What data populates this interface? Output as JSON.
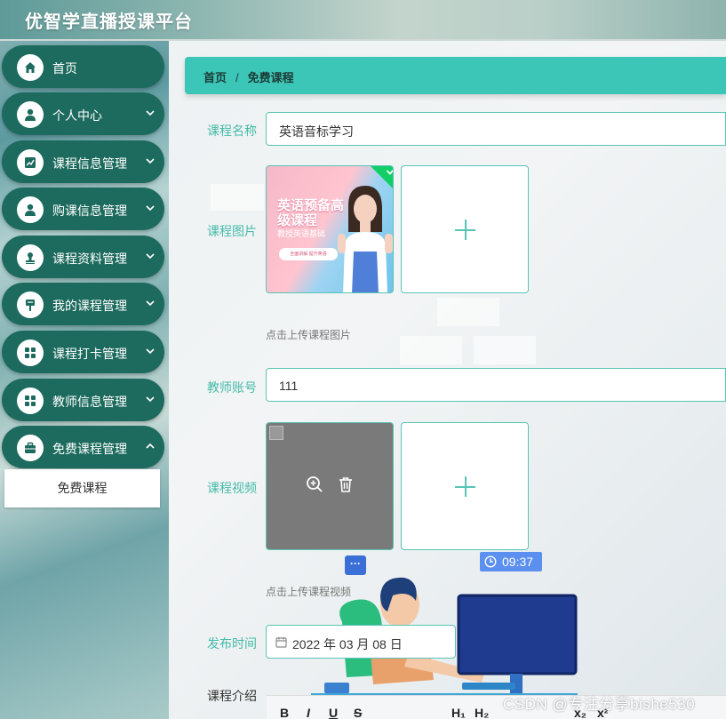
{
  "site": {
    "title": "优智学直播授课平台"
  },
  "sidebar": {
    "items": [
      {
        "label": "首页",
        "icon": "home-icon"
      },
      {
        "label": "个人中心",
        "icon": "user-icon"
      },
      {
        "label": "课程信息管理",
        "icon": "chart-icon"
      },
      {
        "label": "购课信息管理",
        "icon": "user-icon"
      },
      {
        "label": "课程资料管理",
        "icon": "stamp-icon"
      },
      {
        "label": "我的课程管理",
        "icon": "signpost-icon"
      },
      {
        "label": "课程打卡管理",
        "icon": "grid-icon"
      },
      {
        "label": "教师信息管理",
        "icon": "grid-icon"
      },
      {
        "label": "免费课程管理",
        "icon": "briefcase-icon"
      }
    ],
    "submenu": {
      "label": "免费课程"
    }
  },
  "breadcrumb": {
    "home": "首页",
    "separator": "/",
    "current": "免费课程"
  },
  "form": {
    "course_name": {
      "label": "课程名称",
      "value": "英语音标学习"
    },
    "course_image": {
      "label": "课程图片",
      "hint": "点击上传课程图片",
      "poster": {
        "title": "英语预备高级课程",
        "subtitle": "教授英语基础",
        "tag": "全面讲解 提升英语"
      }
    },
    "teacher_account": {
      "label": "教师账号",
      "value": "111"
    },
    "course_video": {
      "label": "课程视频",
      "hint": "点击上传课程视频"
    },
    "publish_time": {
      "label": "发布时间",
      "value": "2022 年 03 月 08 日"
    },
    "course_intro": {
      "label": "课程介绍"
    }
  },
  "overlay": {
    "time": "09:37",
    "chat": "···"
  },
  "editor": {
    "buttons": [
      "B",
      "I",
      "U",
      "S",
      "H₁",
      "H₂",
      "x₂",
      "x²"
    ]
  },
  "watermark": "CSDN @专注分享bishe530",
  "colors": {
    "menu_bg": "#1d6b5e",
    "accent": "#3cc6b7",
    "label": "#45bba9",
    "badge": "#5b8ff0",
    "check": "#13ce66"
  }
}
